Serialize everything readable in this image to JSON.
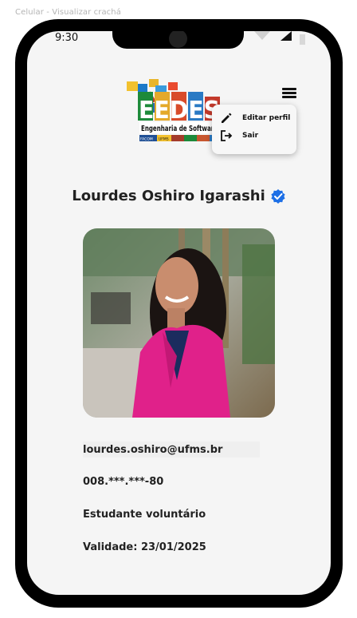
{
  "frame": {
    "label": "Celular - Visualizar crachá"
  },
  "status_bar": {
    "time": "9:30"
  },
  "logo": {
    "big_text": "EEDES",
    "subtitle": "Engenharia de Software",
    "badges": [
      "FACOM",
      "UFMS"
    ]
  },
  "menu": {
    "items": [
      {
        "label": "Editar perfil",
        "icon": "pencil-icon"
      },
      {
        "label": "Sair",
        "icon": "logout-icon"
      }
    ]
  },
  "profile": {
    "name": "Lourdes Oshiro Igarashi",
    "verified": true,
    "email": "lourdes.oshiro@ufms.br",
    "cpf": "008.***.***-80",
    "role": "Estudante voluntário",
    "validity": "Validade: 23/01/2025"
  },
  "colors": {
    "verified": "#1d6fe6",
    "photo_jacket": "#e0218a",
    "screen_bg": "#f5f5f5"
  }
}
